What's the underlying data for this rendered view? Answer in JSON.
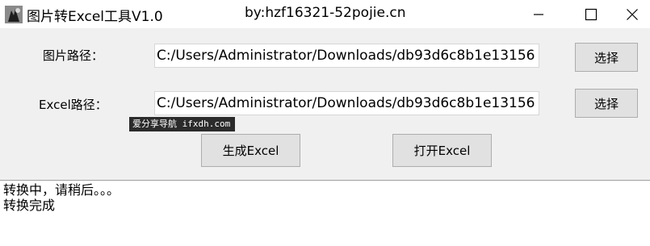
{
  "window": {
    "title": "图片转Excel工具V1.0",
    "author": "by:hzf16321-52pojie.cn"
  },
  "form": {
    "image_path_label": "图片路径：",
    "image_path_value": "C:/Users/Administrator/Downloads/db93d6c8b1e13156",
    "image_browse_label": "选择",
    "excel_path_label": "Excel路径：",
    "excel_path_value": "C:/Users/Administrator/Downloads/db93d6c8b1e13156",
    "excel_browse_label": "选择"
  },
  "actions": {
    "generate_label": "生成Excel",
    "open_label": "打开Excel"
  },
  "watermark": {
    "text": "爱分享导航 ifxdh.com"
  },
  "log": {
    "lines": [
      "转换中，请稍后。。。",
      "转换完成"
    ]
  },
  "icons": {
    "app": "app-icon",
    "minimize": "minimize-icon",
    "maximize": "maximize-icon",
    "close": "close-icon"
  }
}
